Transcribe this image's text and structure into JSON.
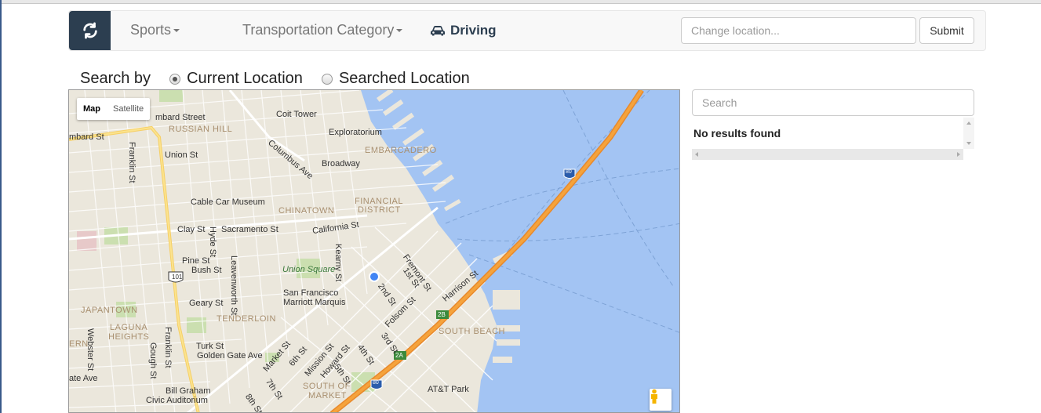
{
  "navbar": {
    "refresh_icon": "refresh-icon",
    "sports_label": "Sports",
    "transport_label": "Transportation Category",
    "driving_label": "Driving",
    "driving_icon": "car-icon",
    "location_placeholder": "Change location...",
    "submit_label": "Submit",
    "brand_color": "#2c3e50"
  },
  "search_by": {
    "label": "Search by",
    "options": [
      {
        "label": "Current Location",
        "selected": true
      },
      {
        "label": "Searched Location",
        "selected": false
      }
    ]
  },
  "map": {
    "type_controls": {
      "map": "Map",
      "satellite": "Satellite"
    },
    "active_type": "Map",
    "labels": {
      "lombard_st": "mbard St",
      "lombard_street": "mbard Street",
      "russian_hill": "RUSSIAN HILL",
      "coit_tower": "Coit Tower",
      "exploratorium": "Exploratorium",
      "embarcadero": "EMBARCADERO",
      "union_st": "Union St",
      "columbus_ave": "Columbus Ave",
      "broadway": "Broadway",
      "franklin_st": "Franklin St",
      "cable_car_museum": "Cable Car Museum",
      "chinatown": "CHINATOWN",
      "financial_district_1": "FINANCIAL",
      "financial_district_2": "DISTRICT",
      "clay_st": "Clay St",
      "hyde_st": "Hyde St",
      "sacramento_st": "Sacramento St",
      "california_st": "California St",
      "pine_st": "Pine St",
      "bush_st": "Bush St",
      "leavenworth_st": "Leavenworth St",
      "kearny_st": "Kearny St",
      "union_square": "Union Square",
      "fremont_st": "Fremont St",
      "first_st": "1st St",
      "second_st": "2nd St",
      "harrison_st": "Harrison St",
      "sf_marriott_1": "San Francisco",
      "sf_marriott_2": "Marriott Marquis",
      "japantown": "JAPANTOWN",
      "geary_st": "Geary St",
      "tenderloin": "TENDERLOIN",
      "folsom_st": "Folsom St",
      "laguna_heights_1": "LAGUNA",
      "laguna_heights_2": "HEIGHTS",
      "third_st": "3rd St",
      "south_beach": "SOUTH BEACH",
      "webster_st": "Webster St",
      "gough_st": "Gough St",
      "franklin_st_2": "Franklin St",
      "turk_st": "Turk St",
      "golden_gate_ave": "Golden Gate Ave",
      "market_st": "Market St",
      "sixth_st": "6th St",
      "mission_st": "Mission St",
      "howard_st": "Howard St",
      "fourth_st": "4th St",
      "fifth_st": "5th St",
      "seventh_st": "7th St",
      "south_of_market_1": "SOUTH OF",
      "south_of_market_2": "MARKET",
      "att_park": "AT&T Park",
      "bill_graham_1": "Bill Graham",
      "bill_graham_2": "Civic Auditorium",
      "eighth_st": "8th St",
      "ern": "ERN",
      "ate_ave": "ate Ave",
      "route_101": "101",
      "route_80_a": "80",
      "route_80_b": "80",
      "exit_2b": "2B",
      "exit_2a": "2A"
    }
  },
  "results_panel": {
    "search_placeholder": "Search",
    "empty_message": "No results found"
  }
}
